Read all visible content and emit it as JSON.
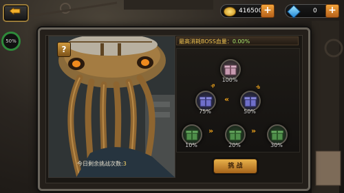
{
  "currency": {
    "gold": "416500",
    "gems": "0",
    "plus": "+"
  },
  "side_indicator": {
    "percent": "50%"
  },
  "panel": {
    "help_symbol": "?",
    "boss_stat_label": "最高消耗BOSS血量：",
    "boss_stat_value": "0.00%",
    "attempts_label": "今日剩余挑战次数:",
    "attempts_value": "3",
    "fight_button": "挑 战"
  },
  "rewards": [
    {
      "id": "top",
      "percent": "100%",
      "tier": "pink"
    },
    {
      "id": "mid-left",
      "percent": "75%",
      "tier": "blue"
    },
    {
      "id": "mid-right",
      "percent": "50%",
      "tier": "blue"
    },
    {
      "id": "low-left",
      "percent": "10%",
      "tier": "green"
    },
    {
      "id": "low-mid",
      "percent": "20%",
      "tier": "green"
    },
    {
      "id": "low-right",
      "percent": "30%",
      "tier": "green"
    }
  ],
  "colors": {
    "pink": "#c79ab0",
    "blue": "#6f6fc9",
    "green": "#4f8f4a",
    "accent": "#f2a51b"
  }
}
